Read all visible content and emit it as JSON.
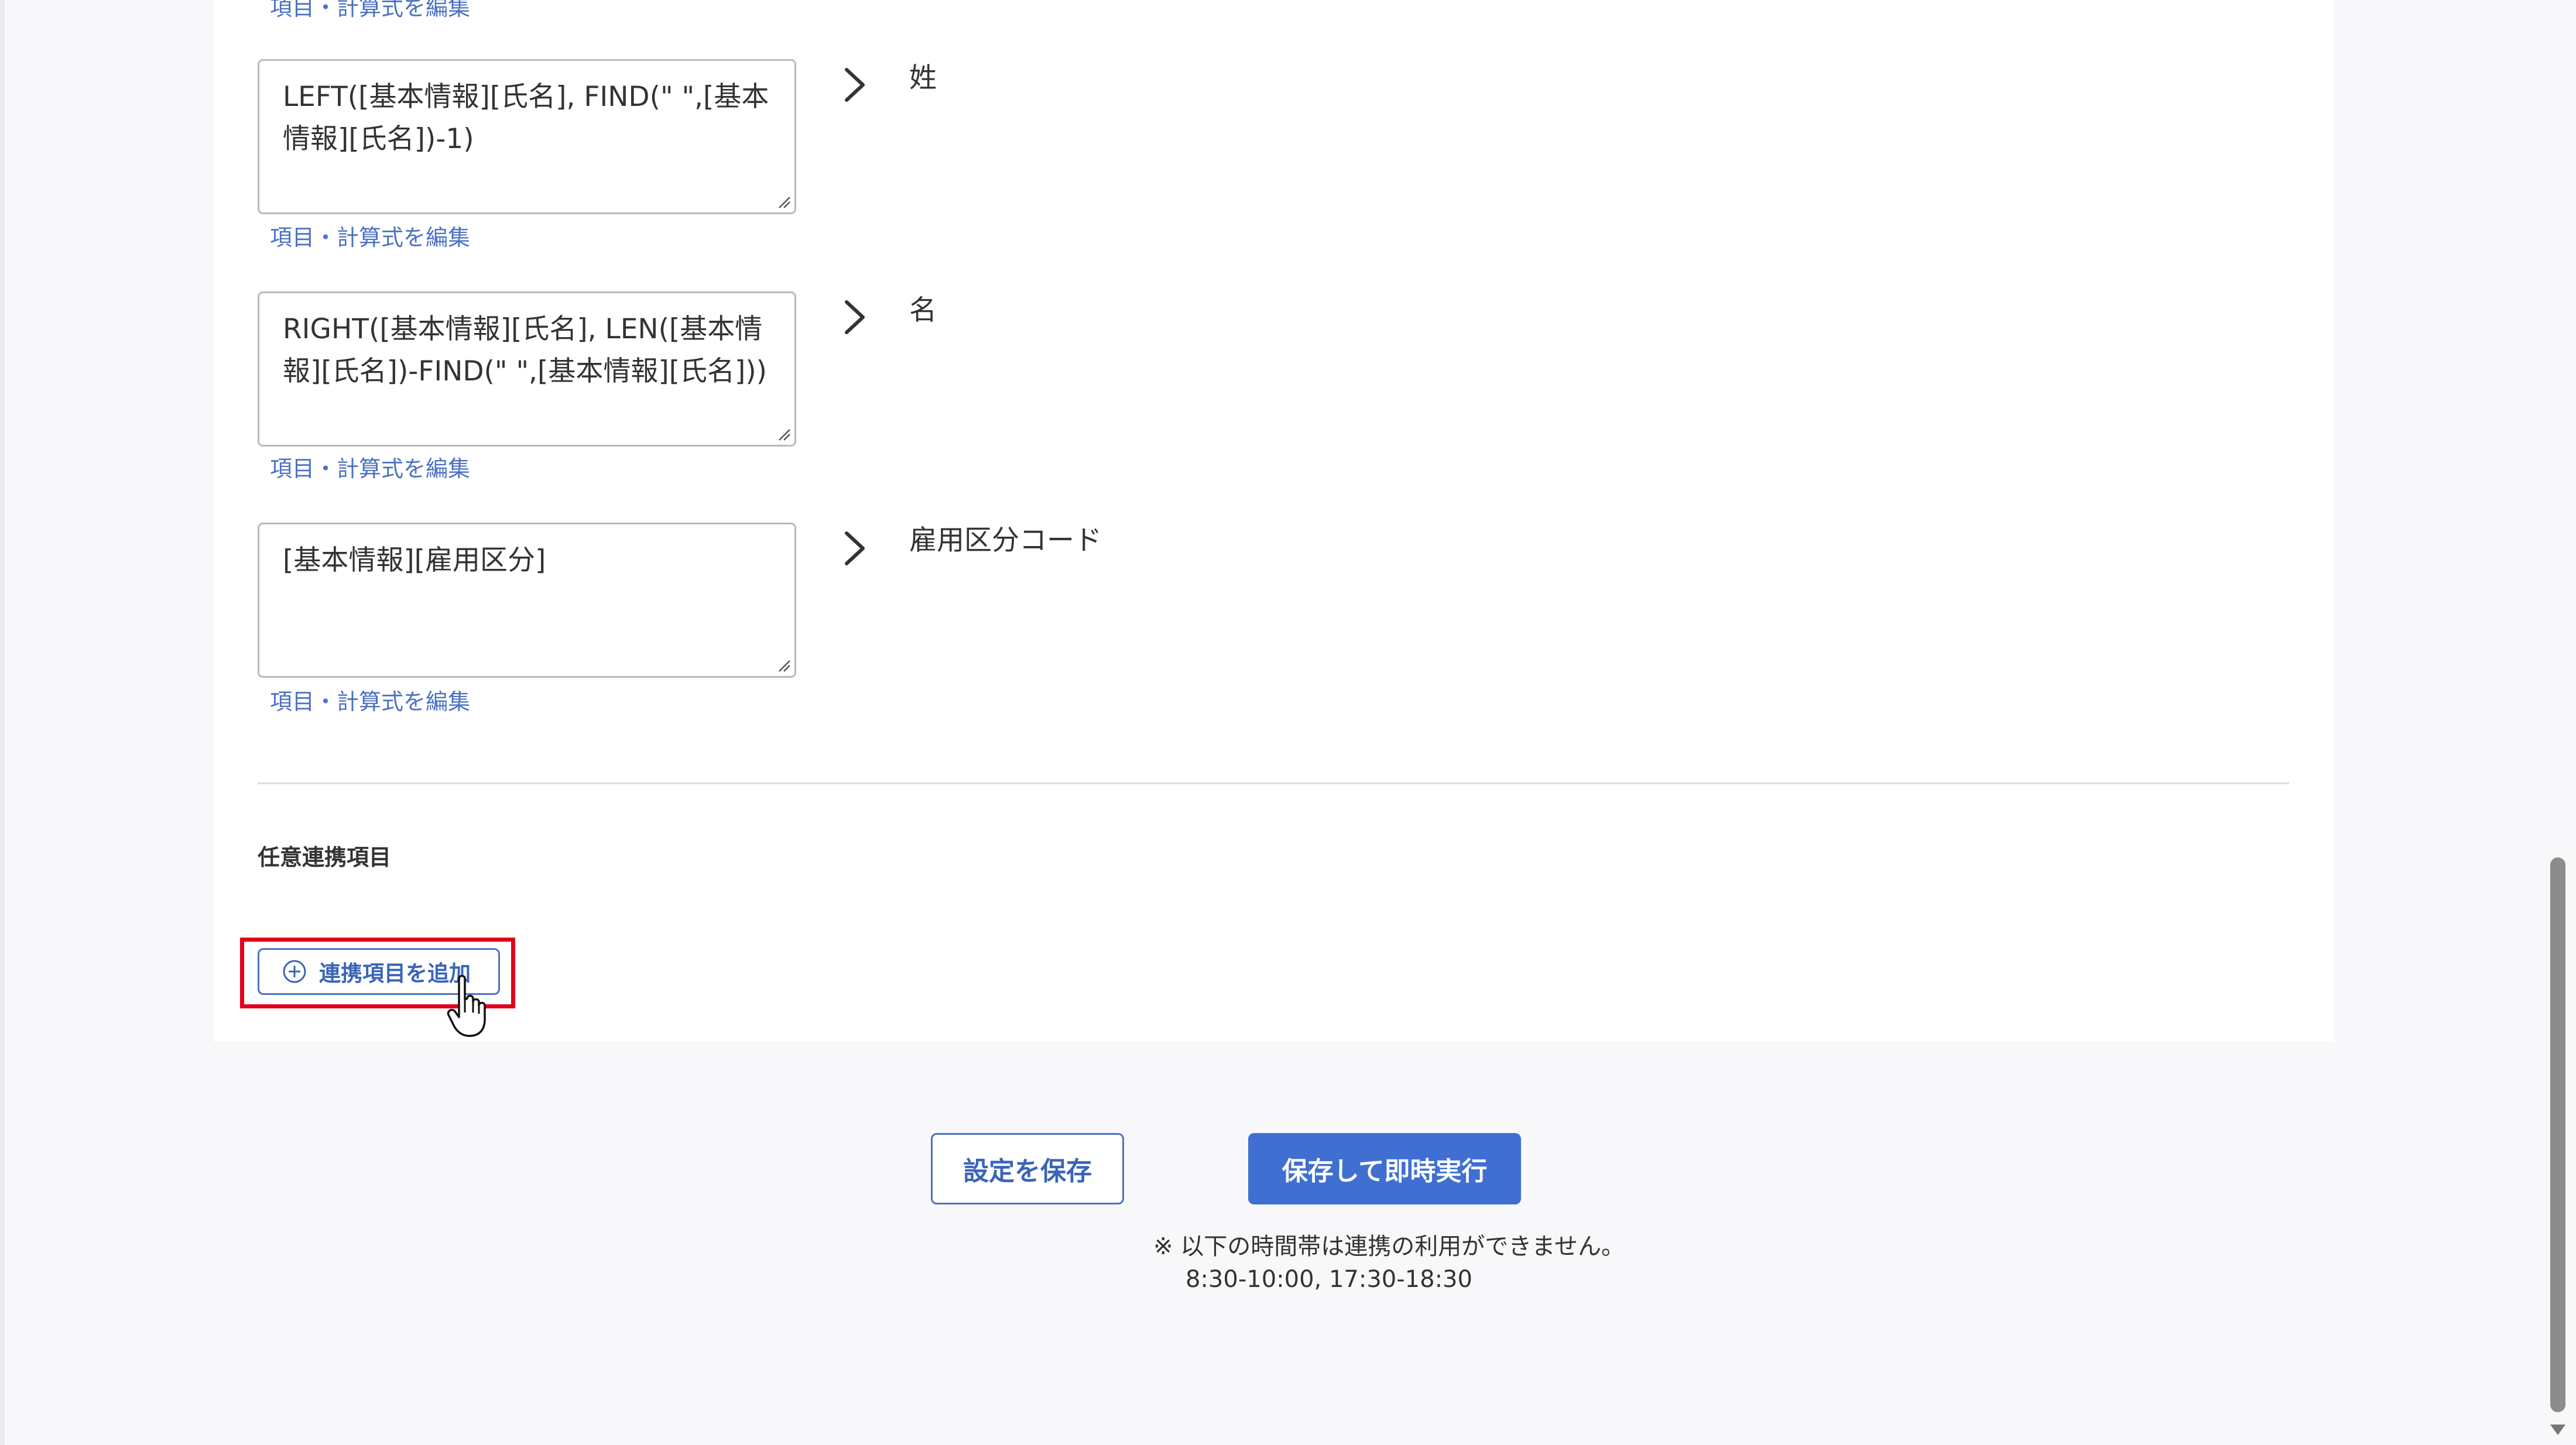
{
  "mappings": [
    {
      "formula_line1": "LEFT([基本情報][氏名], FIND(\" \",[基本",
      "formula_line2": "情報][氏名])-1)",
      "target": "姓"
    },
    {
      "formula_line1": "RIGHT([基本情報][氏名], LEN([基本情",
      "formula_line2": "報][氏名])-FIND(\" \",[基本情報][氏名]))",
      "target": "名"
    },
    {
      "formula_line1": "[基本情報][雇用区分]",
      "formula_line2": "",
      "target": "雇用区分コード"
    }
  ],
  "edit_link_label": "項目・計算式を編集",
  "optional_section": {
    "title": "任意連携項目",
    "add_button_label": "連携項目を追加"
  },
  "actions": {
    "save_label": "設定を保存",
    "save_and_run_label": "保存して即時実行"
  },
  "notice": {
    "line1": "※ 以下の時間帯は連携の利用ができません。",
    "line2": "8:30-10:00, 17:30-18:30"
  },
  "colors": {
    "accent": "#3f6fd1",
    "link": "#4b72c2",
    "highlight": "#e3001b"
  },
  "icons": {
    "arrow": "chevron-right-icon",
    "add": "plus-circle-icon",
    "cursor": "hand-pointer-icon",
    "resize": "resize-grip-icon"
  }
}
